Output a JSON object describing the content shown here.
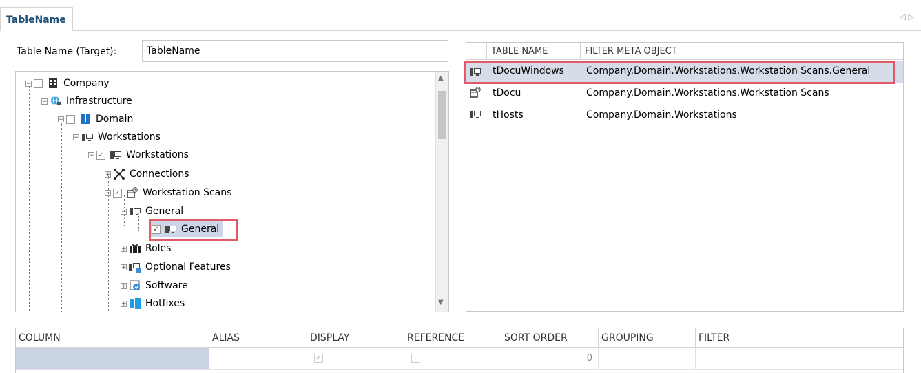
{
  "tab": {
    "title": "TableName"
  },
  "target": {
    "label": "Table Name (Target):",
    "value": "TableName"
  },
  "tree": {
    "nodes": [
      {
        "label": "Company"
      },
      {
        "label": "Infrastructure"
      },
      {
        "label": "Domain"
      },
      {
        "label": "Workstations"
      },
      {
        "label": "Workstations"
      },
      {
        "label": "Connections"
      },
      {
        "label": "Workstation Scans"
      },
      {
        "label": "General"
      },
      {
        "label": "General"
      },
      {
        "label": "Roles"
      },
      {
        "label": "Optional Features"
      },
      {
        "label": "Software"
      },
      {
        "label": "Hotfixes"
      }
    ]
  },
  "table": {
    "columns": [
      "TABLE NAME",
      "FILTER META OBJECT"
    ],
    "rows": [
      {
        "name": "tDocuWindows",
        "filter": "Company.Domain.Workstations.Workstation Scans.General"
      },
      {
        "name": "tDocu",
        "filter": "Company.Domain.Workstations.Workstation Scans"
      },
      {
        "name": "tHosts",
        "filter": "Company.Domain.Workstations"
      }
    ]
  },
  "grid": {
    "columns": [
      "COLUMN",
      "ALIAS",
      "DISPLAY",
      "REFERENCE",
      "SORT ORDER",
      "GROUPING",
      "FILTER"
    ],
    "row": {
      "sort_order": "0"
    }
  },
  "colors": {
    "accent_highlight": "#e05a67",
    "selection": "#cdd6e6",
    "tab_text": "#1f4e79"
  }
}
